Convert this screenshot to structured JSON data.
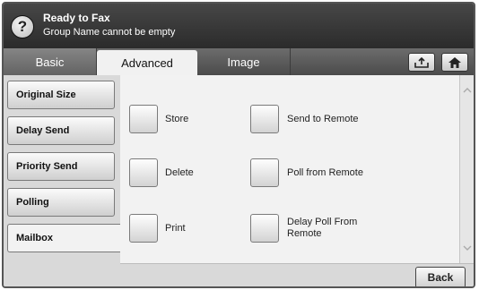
{
  "header": {
    "help_icon": "?",
    "title": "Ready to Fax",
    "message": "Group Name cannot be empty"
  },
  "tabs": [
    {
      "label": "Basic",
      "active": false
    },
    {
      "label": "Advanced",
      "active": true
    },
    {
      "label": "Image",
      "active": false
    }
  ],
  "toolbar_icons": [
    "upload-tray-icon",
    "home-icon"
  ],
  "sidebar": {
    "items": [
      {
        "label": "Original Size"
      },
      {
        "label": "Delay Send"
      },
      {
        "label": "Priority Send"
      },
      {
        "label": "Polling"
      },
      {
        "label": "Mailbox",
        "active": true
      }
    ]
  },
  "options": {
    "store": "Store",
    "delete": "Delete",
    "print": "Print",
    "send_to_remote": "Send to Remote",
    "poll_from_remote": "Poll from Remote",
    "delay_poll_line1": "Delay Poll From",
    "delay_poll_line2": "Remote"
  },
  "scroll_icons": {
    "up": "chevron-up-icon",
    "down": "chevron-down-icon"
  },
  "footer": {
    "back_label": "Back"
  },
  "colors": {
    "header_bg": "#2b2b2b",
    "tab_bar_bg": "#5a5a5a",
    "panel_bg": "#f2f2f2",
    "sidebar_bg": "#d9d9d9"
  }
}
